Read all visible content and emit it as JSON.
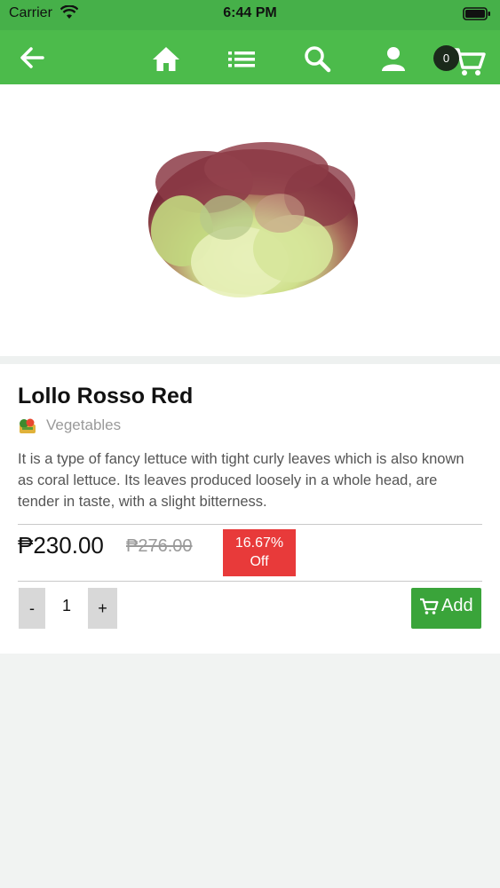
{
  "status_bar": {
    "carrier": "Carrier",
    "time": "6:44 PM"
  },
  "nav": {
    "cart_count": "0",
    "icons": [
      "back-arrow-icon",
      "home-icon",
      "list-icon",
      "search-icon",
      "user-icon",
      "cart-icon"
    ]
  },
  "product": {
    "title": "Lollo Rosso Red",
    "category": "Vegetables",
    "description": "It is a type of fancy lettuce with tight curly leaves which is also known as coral lettuce. Its leaves produced loosely in a whole head, are tender in taste, with a slight bitterness.",
    "price": "₱230.00",
    "old_price": "₱276.00",
    "discount_value": "16.67%",
    "discount_label": "Off",
    "quantity": "1"
  },
  "actions": {
    "decrement_label": "-",
    "increment_label": "+",
    "add_label": "Add"
  },
  "colors": {
    "header": "#4cbb4b",
    "status_bar": "#46b049",
    "discount": "#e83a3a",
    "add_button": "#3aa43a"
  }
}
